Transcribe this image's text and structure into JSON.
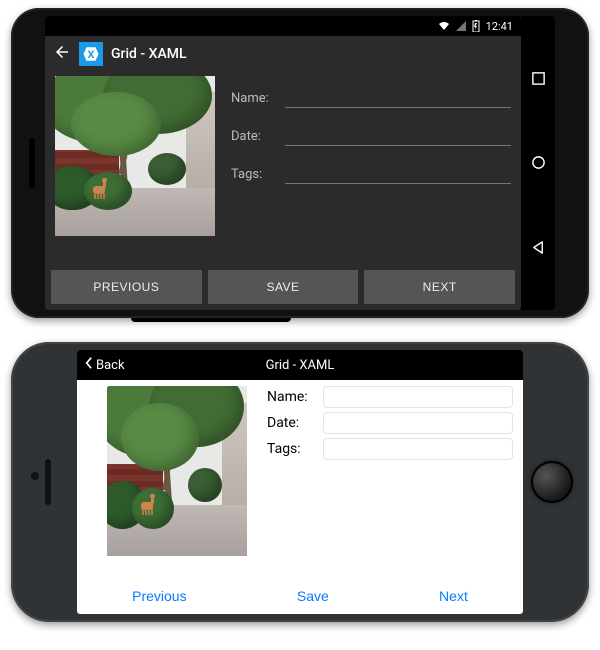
{
  "android": {
    "status": {
      "time": "12:41"
    },
    "appbar": {
      "title": "Grid - XAML"
    },
    "form": {
      "name_label": "Name:",
      "date_label": "Date:",
      "tags_label": "Tags:",
      "name_value": "",
      "date_value": "",
      "tags_value": ""
    },
    "buttons": {
      "previous": "PREVIOUS",
      "save": "SAVE",
      "next": "NEXT"
    }
  },
  "ios": {
    "navbar": {
      "back": "Back",
      "title": "Grid - XAML"
    },
    "form": {
      "name_label": "Name:",
      "date_label": "Date:",
      "tags_label": "Tags:",
      "name_value": "",
      "date_value": "",
      "tags_value": ""
    },
    "buttons": {
      "previous": "Previous",
      "save": "Save",
      "next": "Next"
    }
  }
}
